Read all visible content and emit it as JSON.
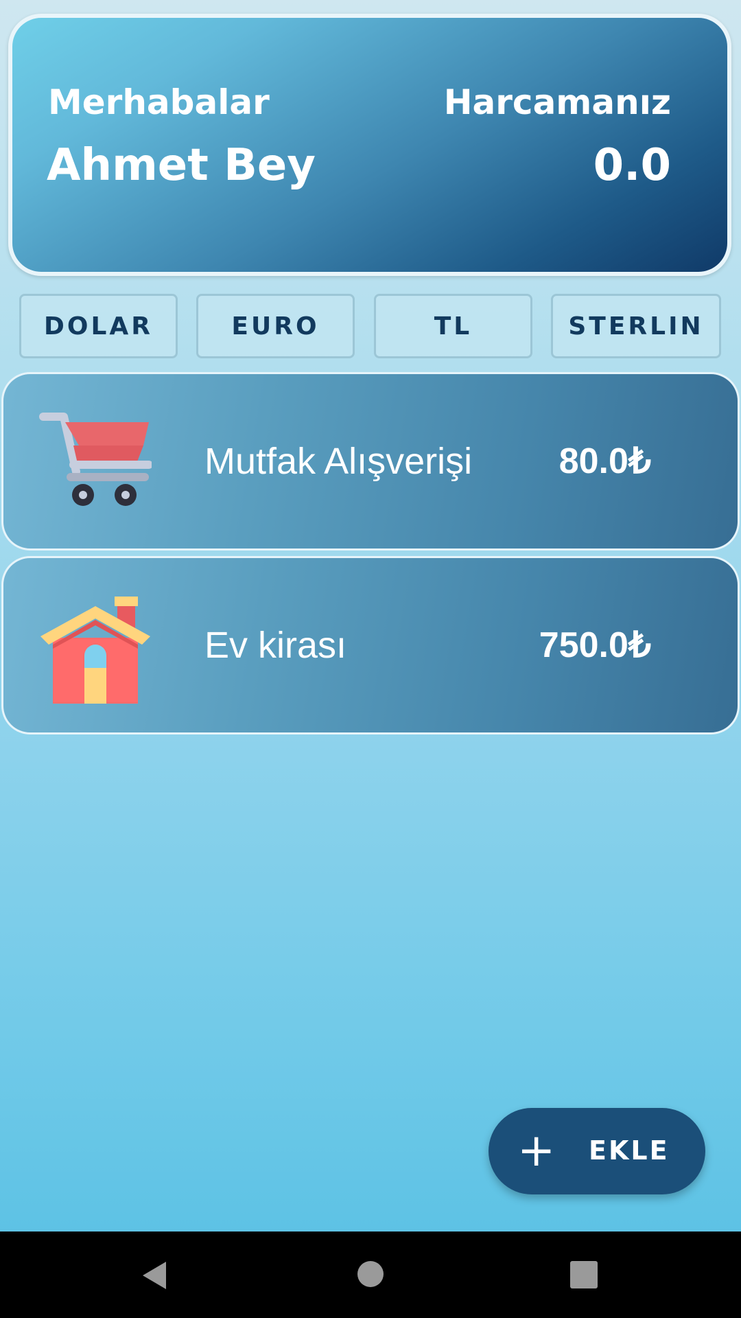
{
  "header": {
    "greeting": "Merhabalar",
    "user_name": "Ahmet Bey",
    "spending_label": "Harcamanız",
    "spending_total": "0.0"
  },
  "currencies": [
    {
      "label": "DOLAR"
    },
    {
      "label": "EURO"
    },
    {
      "label": "TL"
    },
    {
      "label": "STERLIN"
    }
  ],
  "expenses": [
    {
      "icon": "shopping-cart-icon",
      "title": "Mutfak Alışverişi",
      "amount": "80.0₺"
    },
    {
      "icon": "house-icon",
      "title": "Ev kirası",
      "amount": "750.0₺"
    }
  ],
  "fab": {
    "icon": "plus-icon",
    "label": "EKLE"
  },
  "navigation": {
    "back_icon": "back-triangle-icon",
    "home_icon": "home-circle-icon",
    "recents_icon": "recents-square-icon"
  },
  "colors": {
    "header_dark": "#103a68",
    "header_light": "#6fcfe8",
    "fab": "#1b4f79",
    "currency_text": "#123a5e"
  }
}
